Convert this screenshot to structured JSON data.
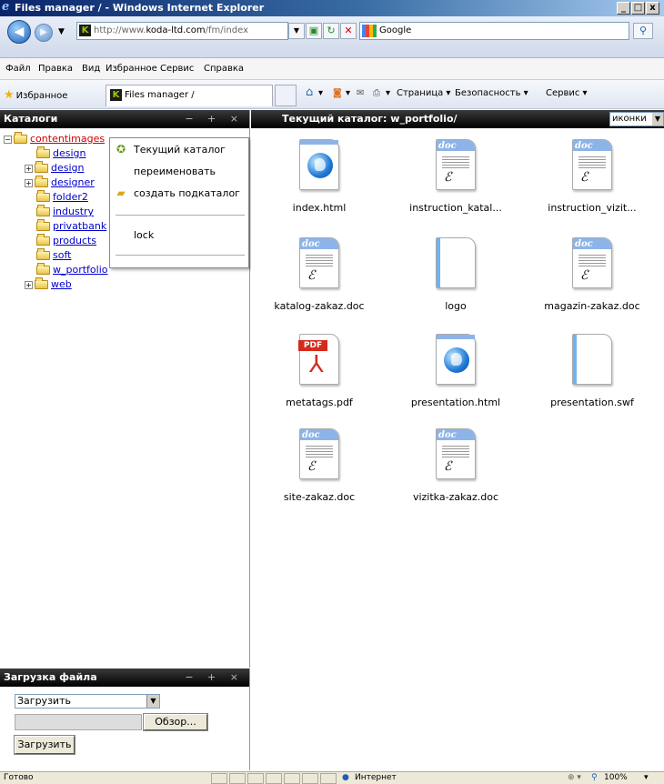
{
  "window": {
    "title": "Files manager / - Windows Internet Explorer",
    "btn_min": "_",
    "btn_max": "□",
    "btn_close": "x"
  },
  "address": {
    "url_prefix": "http://www.",
    "url_domain": "koda-ltd.com",
    "url_suffix": "/fm/index",
    "search_placeholder": "Google"
  },
  "menu": [
    "Файл",
    "Правка",
    "Вид",
    "Избранное",
    "Сервис",
    "Справка"
  ],
  "favbar": {
    "favorites_label": "Избранное",
    "tab_title": "Files manager /",
    "page_label": "Страница ▾",
    "safety_label": "Безопасность ▾",
    "service_label": "Сервис ▾"
  },
  "left_panel": {
    "title": "Каталоги",
    "controls": "− + ×",
    "tree": [
      {
        "name": "contentimages",
        "expander": "−",
        "selected": true
      },
      {
        "name": "design",
        "expander": ""
      },
      {
        "name": "design",
        "expander": "+"
      },
      {
        "name": "designer",
        "expander": "+"
      },
      {
        "name": "folder2",
        "expander": ""
      },
      {
        "name": "industry",
        "expander": ""
      },
      {
        "name": "privatbank",
        "expander": ""
      },
      {
        "name": "products",
        "expander": ""
      },
      {
        "name": "soft",
        "expander": ""
      },
      {
        "name": "w_portfolio",
        "expander": ""
      },
      {
        "name": "web",
        "expander": "+"
      }
    ]
  },
  "context_menu": {
    "items": [
      "Текущий каталог",
      "переименовать",
      "создать подкаталог",
      "lock"
    ]
  },
  "upload_panel": {
    "title": "Загрузка файла",
    "controls": "− + ×",
    "select_value": "Загрузить",
    "browse_label": "Обзор...",
    "submit_label": "Загрузить"
  },
  "right_panel": {
    "title": "Текущий каталог: w_portfolio/",
    "view_select": "иконки",
    "files": [
      {
        "name": "index.html",
        "kind": "web"
      },
      {
        "name": "instruction_katal...",
        "kind": "doc"
      },
      {
        "name": "instruction_vizit...",
        "kind": "doc"
      },
      {
        "name": "katalog-zakaz.doc",
        "kind": "doc"
      },
      {
        "name": "logo",
        "kind": "blank"
      },
      {
        "name": "magazin-zakaz.doc",
        "kind": "doc"
      },
      {
        "name": "metatags.pdf",
        "kind": "pdf"
      },
      {
        "name": "presentation.html",
        "kind": "web"
      },
      {
        "name": "presentation.swf",
        "kind": "blank"
      },
      {
        "name": "site-zakaz.doc",
        "kind": "doc"
      },
      {
        "name": "vizitka-zakaz.doc",
        "kind": "doc"
      }
    ]
  },
  "statusbar": {
    "status": "Готово",
    "zone": "Интернет",
    "zoom": "100%"
  }
}
